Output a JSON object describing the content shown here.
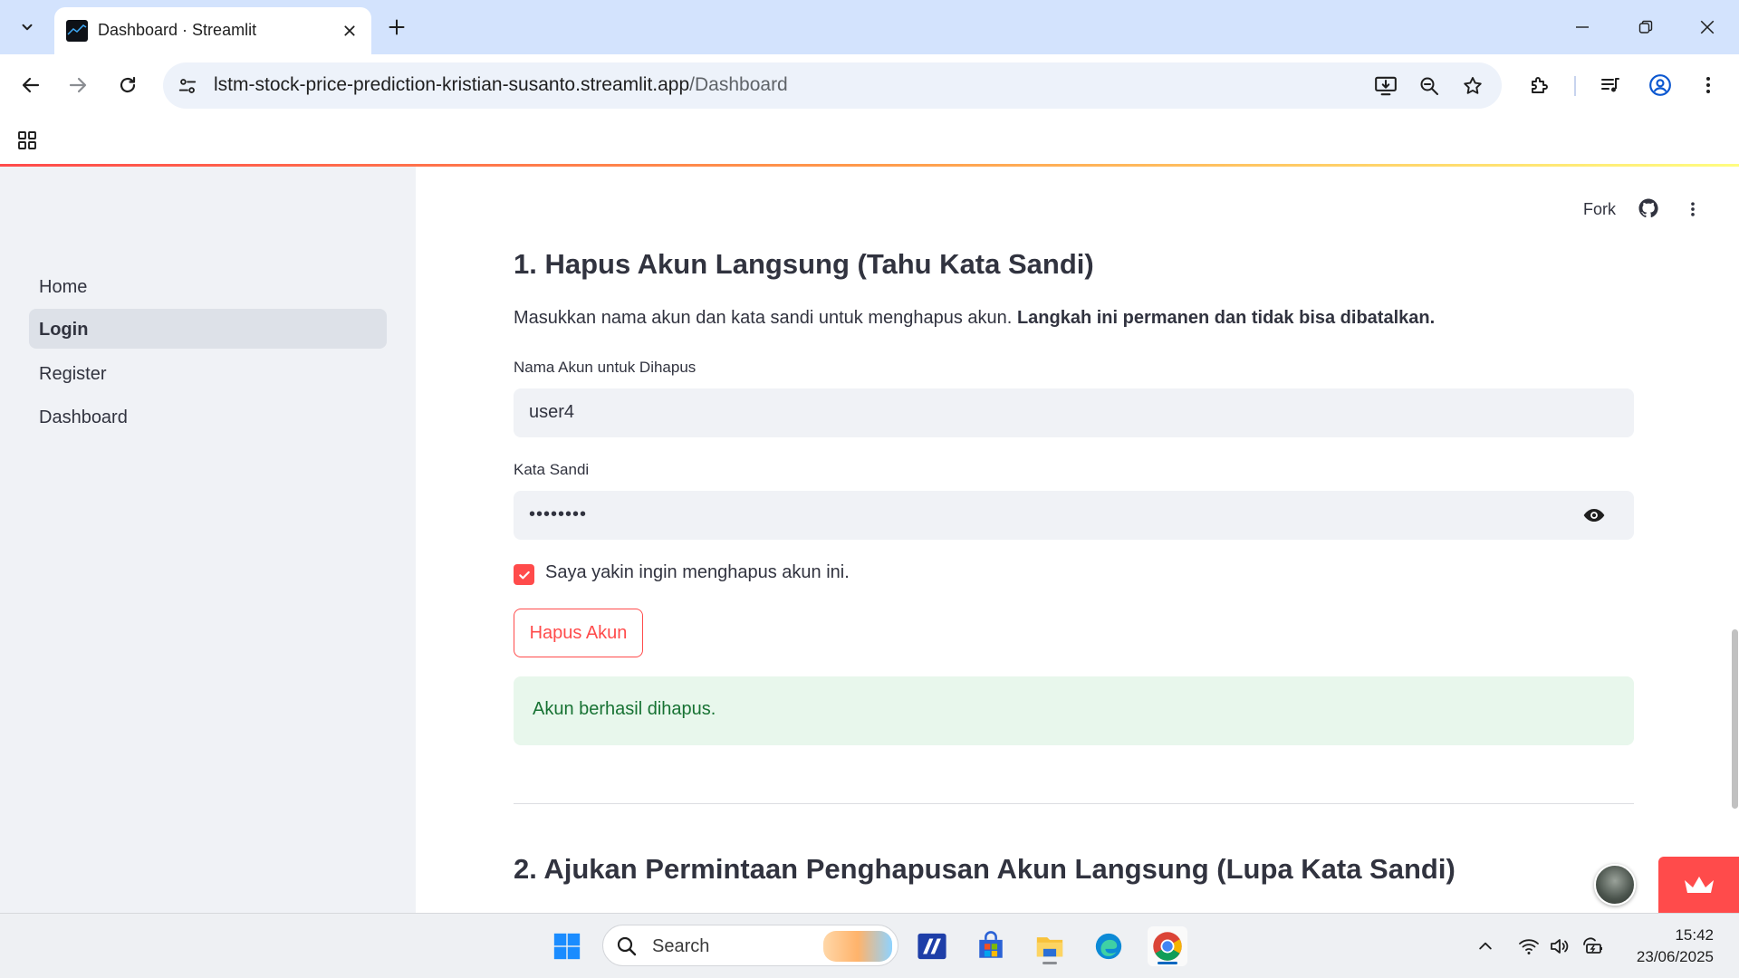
{
  "browser": {
    "tab_title": "Dashboard · Streamlit",
    "url_domain": "lstm-stock-price-prediction-kristian-susanto.streamlit.app",
    "url_path": "/Dashboard"
  },
  "sidebar": {
    "items": [
      {
        "label": "Home",
        "active": false
      },
      {
        "label": "Login",
        "active": true
      },
      {
        "label": "Register",
        "active": false
      },
      {
        "label": "Dashboard",
        "active": false
      }
    ]
  },
  "header": {
    "fork_label": "Fork"
  },
  "main": {
    "section1_title": "1. Hapus Akun Langsung (Tahu Kata Sandi)",
    "section1_desc": "Masukkan nama akun dan kata sandi untuk menghapus akun.",
    "section1_desc_bold": "Langkah ini permanen dan tidak bisa dibatalkan.",
    "account_label": "Nama Akun untuk Dihapus",
    "account_value": "user4",
    "password_label": "Kata Sandi",
    "password_value": "••••••••",
    "confirm_label": "Saya yakin ingin menghapus akun ini.",
    "confirm_checked": true,
    "delete_button": "Hapus Akun",
    "success_message": "Akun berhasil dihapus.",
    "section2_title": "2. Ajukan Permintaan Penghapusan Akun Langsung (Lupa Kata Sandi)"
  },
  "taskbar": {
    "search_placeholder": "Search",
    "time": "15:42",
    "date": "23/06/2025"
  },
  "colors": {
    "accent": "#ff4b4b",
    "success_bg": "#e8f7ec",
    "success_text": "#177233",
    "sidebar_bg": "#f0f2f6"
  }
}
